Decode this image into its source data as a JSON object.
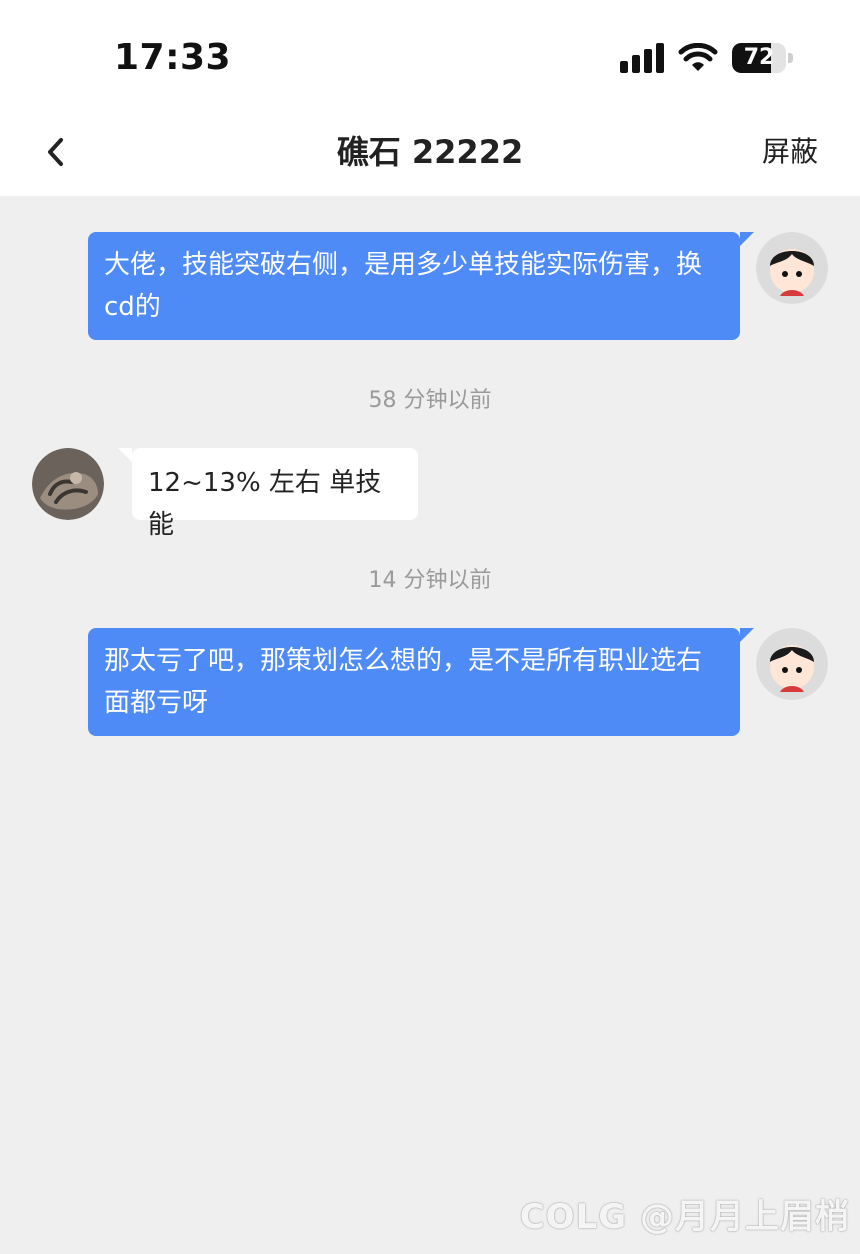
{
  "status_bar": {
    "time": "17:33",
    "battery_percent": "72",
    "battery_level": 0.72
  },
  "nav": {
    "title": "礁石 22222",
    "action_label": "屏蔽",
    "back_icon": "chevron-left-icon"
  },
  "messages": [
    {
      "direction": "out",
      "text": "大佬，技能突破右侧，是用多少单技能实际伤害，换cd的"
    },
    {
      "direction": "in",
      "text": "12~13% 左右 单技能"
    },
    {
      "direction": "out",
      "text": "那太亏了吧，那策划怎么想的，是不是所有职业选右面都亏呀"
    }
  ],
  "timestamps": [
    "58 分钟以前",
    "14 分钟以前"
  ],
  "colors": {
    "outgoing_bubble": "#4e8bf7",
    "incoming_bubble": "#ffffff",
    "chat_background": "#efefef"
  },
  "watermark": "COLG @月月上眉梢"
}
